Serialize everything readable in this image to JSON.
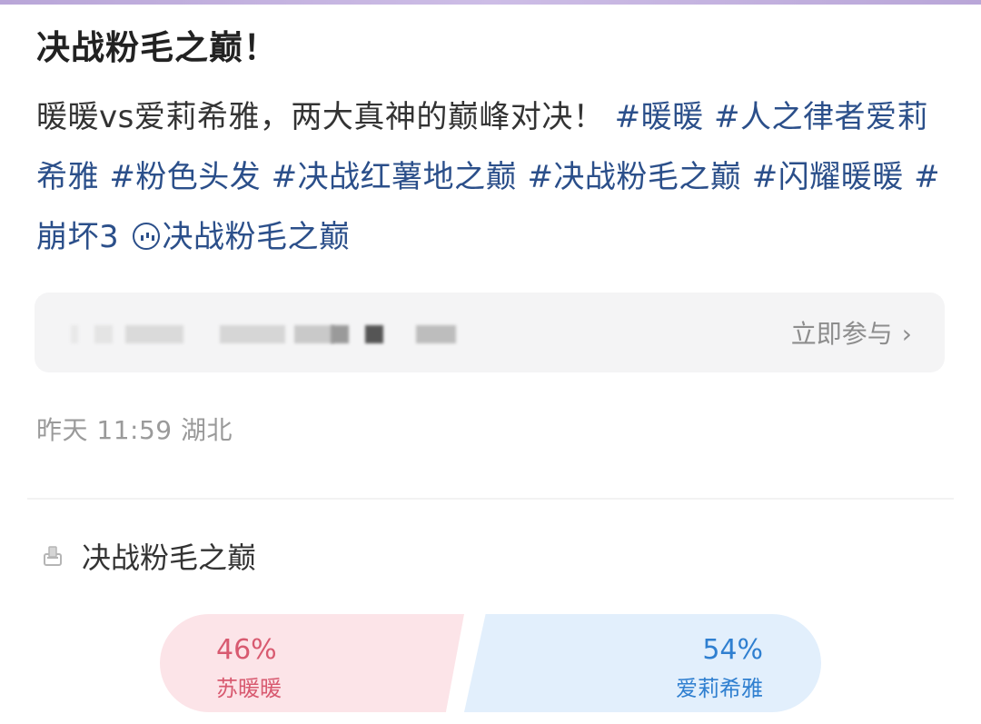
{
  "post": {
    "title": "决战粉毛之巅！",
    "body_intro": "暖暖vs爱莉希雅，两大真神的巅峰对决！",
    "hashtags": [
      "#暖暖",
      "#人之律者爱莉希雅",
      "#粉色头发",
      "#决战红薯地之巅",
      "#决战粉毛之巅",
      "#闪耀暖暖",
      "#崩坏3"
    ],
    "super_topic": "决战粉毛之巅",
    "super_topic_icon": "super-topic-icon"
  },
  "activity": {
    "join_label": "立即参与",
    "chevron": "›"
  },
  "meta": {
    "time": "昨天 11:59",
    "location": "湖北"
  },
  "vote": {
    "icon": "vote-icon",
    "title": "决战粉毛之巅",
    "options": [
      {
        "percent": "46%",
        "name": "苏暖暖",
        "share": 0.46,
        "color": "#d85a70"
      },
      {
        "percent": "54%",
        "name": "爱莉希雅",
        "share": 0.54,
        "color": "#2f7fd0"
      }
    ]
  }
}
